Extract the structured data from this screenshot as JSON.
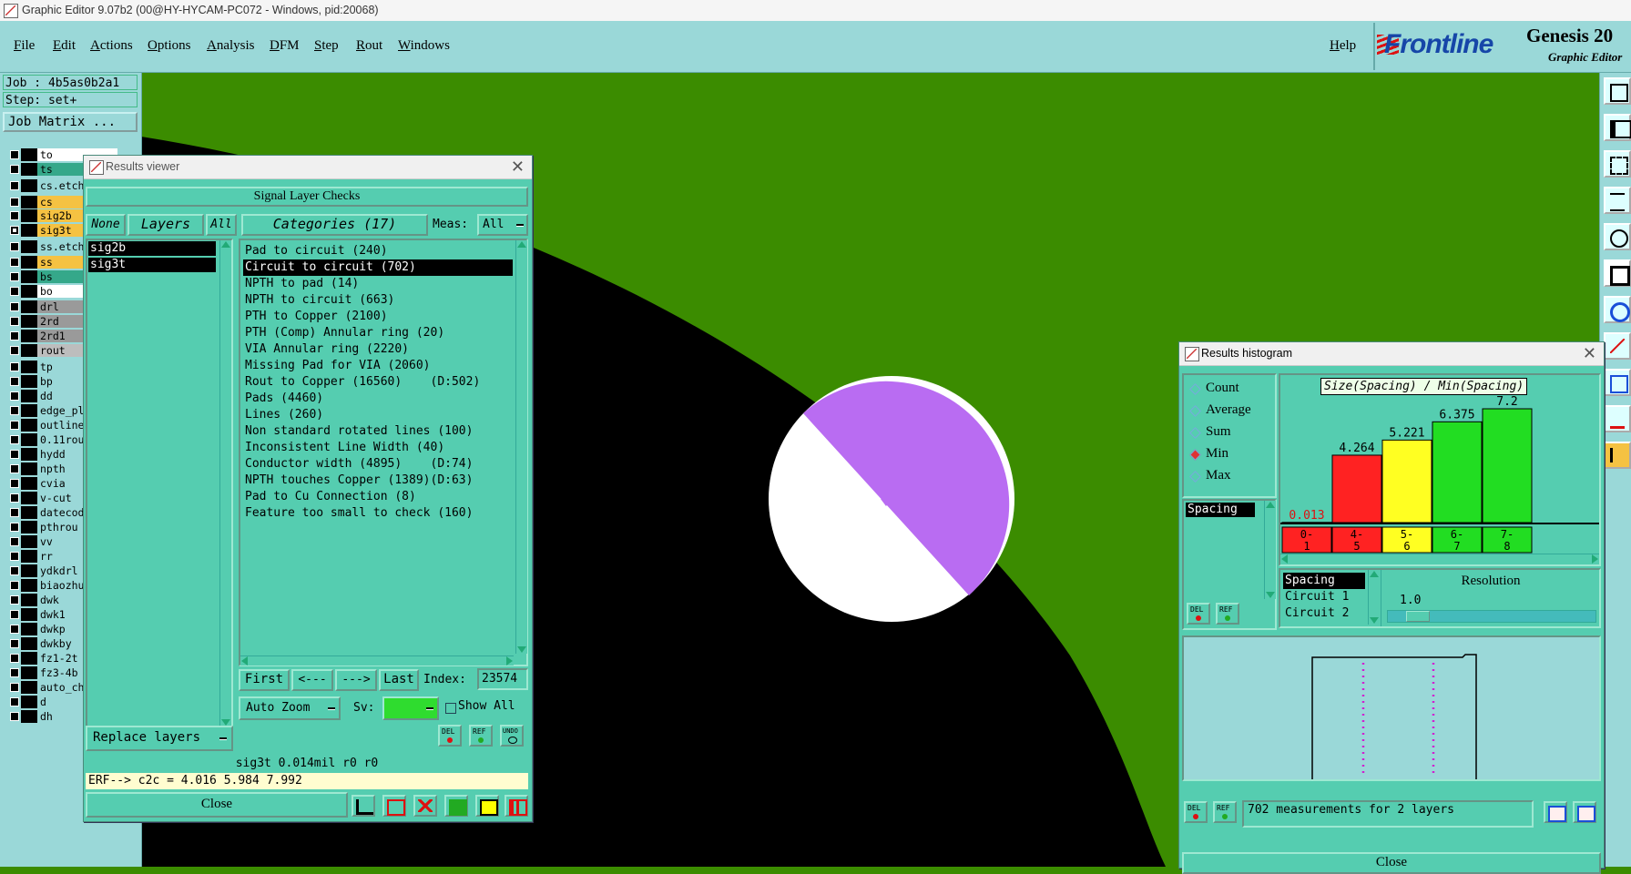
{
  "window": {
    "title": "Graphic Editor 9.07b2 (00@HY-HYCAM-PC072 - Windows, pid:20068)"
  },
  "menu": [
    "File",
    "Edit",
    "Actions",
    "Options",
    "Analysis",
    "DFM",
    "Step",
    "Rout",
    "Windows"
  ],
  "help": "Help",
  "brand": {
    "logo": "Frontline",
    "product": "Genesis 20",
    "subtitle": "Graphic Editor"
  },
  "job": {
    "job": "Job : 4b5as0b2a1",
    "step": "Step: set+",
    "matrix_button": "Job Matrix ..."
  },
  "layers": [
    {
      "name": "to",
      "color": "#ffffff",
      "checked": false
    },
    {
      "name": "ts",
      "color": "#35a88a",
      "checked": false
    },
    {
      "name": "cs.etch",
      "color": "#9ad8d8",
      "checked": false
    },
    {
      "name": "cs",
      "color": "#f5c242",
      "checked": false
    },
    {
      "name": "sig2b",
      "color": "#f5c242",
      "checked": false
    },
    {
      "name": "sig3t",
      "color": "#f5c242",
      "checked": true
    },
    {
      "name": "ss.etch",
      "color": "#9ad8d8",
      "checked": false
    },
    {
      "name": "ss",
      "color": "#f5c242",
      "checked": false
    },
    {
      "name": "bs",
      "color": "#35a88a",
      "checked": false
    },
    {
      "name": "bo",
      "color": "#ffffff",
      "checked": false
    },
    {
      "name": "drl",
      "color": "#9a9a9a",
      "checked": false
    },
    {
      "name": "2rd",
      "color": "#9a9a9a",
      "checked": false
    },
    {
      "name": "2rd1",
      "color": "#9a9a9a",
      "checked": false
    },
    {
      "name": "rout",
      "color": "#bdbdbd",
      "checked": false
    },
    {
      "name": "tp",
      "color": "#9ad8d8",
      "checked": false
    },
    {
      "name": "bp",
      "color": "#9ad8d8",
      "checked": false
    },
    {
      "name": "dd",
      "color": "#9ad8d8",
      "checked": false
    },
    {
      "name": "edge_pl",
      "color": "#9ad8d8",
      "checked": false
    },
    {
      "name": "outline",
      "color": "#9ad8d8",
      "checked": false
    },
    {
      "name": "0.11rou",
      "color": "#9ad8d8",
      "checked": false
    },
    {
      "name": "hydd",
      "color": "#9ad8d8",
      "checked": false
    },
    {
      "name": "npth",
      "color": "#9ad8d8",
      "checked": false
    },
    {
      "name": "cvia",
      "color": "#9ad8d8",
      "checked": false
    },
    {
      "name": "v-cut",
      "color": "#9ad8d8",
      "checked": false
    },
    {
      "name": "datecod",
      "color": "#9ad8d8",
      "checked": false
    },
    {
      "name": "pthrou",
      "color": "#9ad8d8",
      "checked": false
    },
    {
      "name": "vv",
      "color": "#9ad8d8",
      "checked": false
    },
    {
      "name": "rr",
      "color": "#9ad8d8",
      "checked": false
    },
    {
      "name": "ydkdrl",
      "color": "#9ad8d8",
      "checked": false
    },
    {
      "name": "biaozhu",
      "color": "#9ad8d8",
      "checked": false
    },
    {
      "name": "dwk",
      "color": "#9ad8d8",
      "checked": false
    },
    {
      "name": "dwk1",
      "color": "#9ad8d8",
      "checked": false
    },
    {
      "name": "dwkp",
      "color": "#9ad8d8",
      "checked": false
    },
    {
      "name": "dwkby",
      "color": "#9ad8d8",
      "checked": false
    },
    {
      "name": "fz1-2t",
      "color": "#9ad8d8",
      "checked": false
    },
    {
      "name": "fz3-4b",
      "color": "#9ad8d8",
      "checked": false
    },
    {
      "name": "auto_ch",
      "color": "#9ad8d8",
      "checked": false
    },
    {
      "name": "d",
      "color": "#9ad8d8",
      "checked": false
    },
    {
      "name": "dh",
      "color": "#9ad8d8",
      "checked": false
    }
  ],
  "results_viewer": {
    "title": "Results viewer",
    "header": "Signal Layer Checks",
    "none": "None",
    "layers": "Layers",
    "all": "All",
    "categories": "Categories (17)",
    "meas_label": "Meas:",
    "meas_value": "All",
    "layer_list": [
      "sig2b",
      "sig3t"
    ],
    "category_list": [
      "Pad to circuit (240)",
      "Circuit to circuit (702)",
      "NPTH to pad (14)",
      "NPTH to circuit (663)",
      "PTH to Copper (2100)",
      "PTH (Comp) Annular ring (20)",
      "VIA Annular ring (2220)",
      "Missing Pad for VIA (2060)",
      "Rout to Copper (16560)    (D:502)",
      "Pads (4460)",
      "Lines (260)",
      "Non standard rotated lines (100)",
      "Inconsistent Line Width (40)",
      "Conductor width (4895)    (D:74)",
      "NPTH touches Copper (1389)(D:63)",
      "Pad to Cu Connection (8)",
      "Feature too small to check (160)"
    ],
    "selected_category": 1,
    "first": "First",
    "prev": "<---",
    "next": "--->",
    "last": "Last",
    "index_label": "Index:",
    "index_value": "23574",
    "auto_zoom": "Auto Zoom",
    "sv_label": "Sv:",
    "show_all": "Show All",
    "replace_layers": "Replace layers",
    "del": "DEL",
    "ref": "REF",
    "undo": "UNDO",
    "status": "sig3t 0.014mil  r0  r0",
    "erf": "ERF--> c2c = 4.016 5.984 7.992",
    "close": "Close"
  },
  "histogram": {
    "title": "Results histogram",
    "modes": [
      "Count",
      "Average",
      "Sum",
      "Min",
      "Max"
    ],
    "active_mode": "Min",
    "list_label": "Spacing",
    "chart_title": "Size(Spacing) / Min(Spacing)",
    "measure_list": [
      "Spacing",
      "Circuit 1",
      "Circuit 2"
    ],
    "resolution_label": "Resolution",
    "resolution_value": "1.0",
    "summary": "702 measurements for 2 layers",
    "close": "Close",
    "del": "DEL",
    "ref": "REF"
  },
  "chart_data": {
    "type": "bar",
    "title": "Size(Spacing) / Min(Spacing)",
    "categories": [
      "0-1",
      "4-5",
      "5-6",
      "6-7",
      "7-8"
    ],
    "values": [
      0.013,
      4.264,
      5.221,
      6.375,
      7.2
    ],
    "value_labels": [
      "0.013",
      "4.264",
      "5.221",
      "6.375",
      "7.2"
    ],
    "colors": [
      "#ff2222",
      "#ff2222",
      "#ffff22",
      "#22dd22",
      "#22dd22"
    ],
    "ylim": [
      0,
      7.2
    ],
    "grid": false,
    "legend": "none"
  }
}
